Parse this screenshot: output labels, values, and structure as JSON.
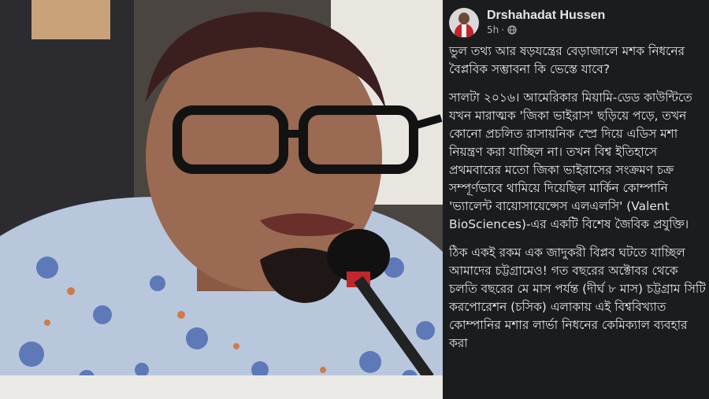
{
  "post": {
    "author": "Drshahadat Hussen",
    "time": "5h",
    "time_separator": "·",
    "privacy_icon": "globe-icon",
    "paragraphs": [
      "ভুল তথ্য আর ষড়যন্ত্রের বেড়াজালে মশক নিধনের বৈপ্লবিক সম্ভাবনা কি ভেস্তে যাবে?",
      "সালটা ২০১৬। আমেরিকার মিয়ামি-ডেড কাউন্টিতে যখন মারাত্মক 'জিকা ভাইরাস' ছড়িয়ে পড়ে, তখন কোনো প্রচলিত রাসায়নিক স্প্রে দিয়ে এডিস মশা নিয়ন্ত্রণ করা যাচ্ছিল না। তখন বিশ্ব ইতিহাসে প্রথমবারের মতো জিকা ভাইরাসের সংক্রমণ চক্র সম্পূর্ণভাবে থামিয়ে দিয়েছিল মার্কিন কোম্পানি 'ভ্যালেন্ট বায়োসায়েন্সেস এলএলসি' (Valent BioSciences)-এর একটি বিশেষ জৈবিক প্রযুক্তি।",
      "ঠিক একই রকম এক জাদুকরী বিপ্লব ঘটতে যাচ্ছিল আমাদের চট্টগ্রামেও! গত বছরের অক্টোবর থেকে চলতি বছরের মে মাস পর্যন্ত (দীর্ঘ ৮ মাস) চট্টগ্রাম সিটি করপোরেশন (চসিক) এলাকায় এই বিশ্ববিখ্যাত কোম্পানির মশার লার্ভা নিধনের কেমিক্যাল ব্যবহার করা"
    ]
  },
  "colors": {
    "post_bg": "#1b1c1e",
    "text": "#e4e6eb",
    "muted": "#b0b3b8"
  }
}
